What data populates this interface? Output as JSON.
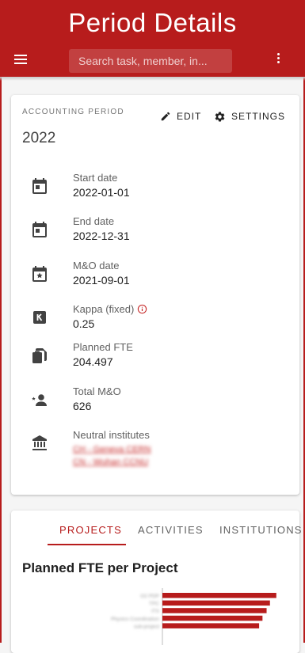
{
  "appbar": {
    "title": "Period Details",
    "search_placeholder": "Search task, member, in...",
    "bar_color": "#b71c1c"
  },
  "period": {
    "overline": "ACCOUNTING PERIOD",
    "year": "2022",
    "edit_label": "EDIT",
    "settings_label": "SETTINGS",
    "fields": [
      {
        "icon": "calendar-icon",
        "label": "Start date",
        "value": "2022-01-01"
      },
      {
        "icon": "calendar-icon",
        "label": "End date",
        "value": "2022-12-31"
      },
      {
        "icon": "calendar-star-icon",
        "label": "M&O date",
        "value": "2021-09-01"
      },
      {
        "icon": "kappa-icon",
        "label": "Kappa (fixed)",
        "value": "0.25"
      },
      {
        "icon": "clipboard-icon",
        "label": "Planned FTE",
        "value": "204.497"
      },
      {
        "icon": "person-star-icon",
        "label": "Total M&O",
        "value": "626"
      },
      {
        "icon": "institution-icon",
        "label": "Neutral institutes",
        "value": ""
      }
    ],
    "neutral_institutes": [
      "CH - Geneva CERN",
      "CN - Wuhan CCNU"
    ]
  },
  "tabs": {
    "items": [
      "PROJECTS",
      "ACTIVITIES",
      "INSTITUTIONS"
    ],
    "active": "PROJECTS"
  },
  "chart_data": {
    "type": "bar",
    "title": "Planned FTE per Project",
    "orientation": "horizontal",
    "categories": [
      "O2 PDP",
      "TPC",
      "ITS",
      "Physics Coordination",
      "sub-project"
    ],
    "values": [
      30.5,
      28.8,
      27.9,
      26.8,
      25.9
    ],
    "xlim": [
      0,
      35
    ],
    "bar_color": "#b71c1c"
  }
}
